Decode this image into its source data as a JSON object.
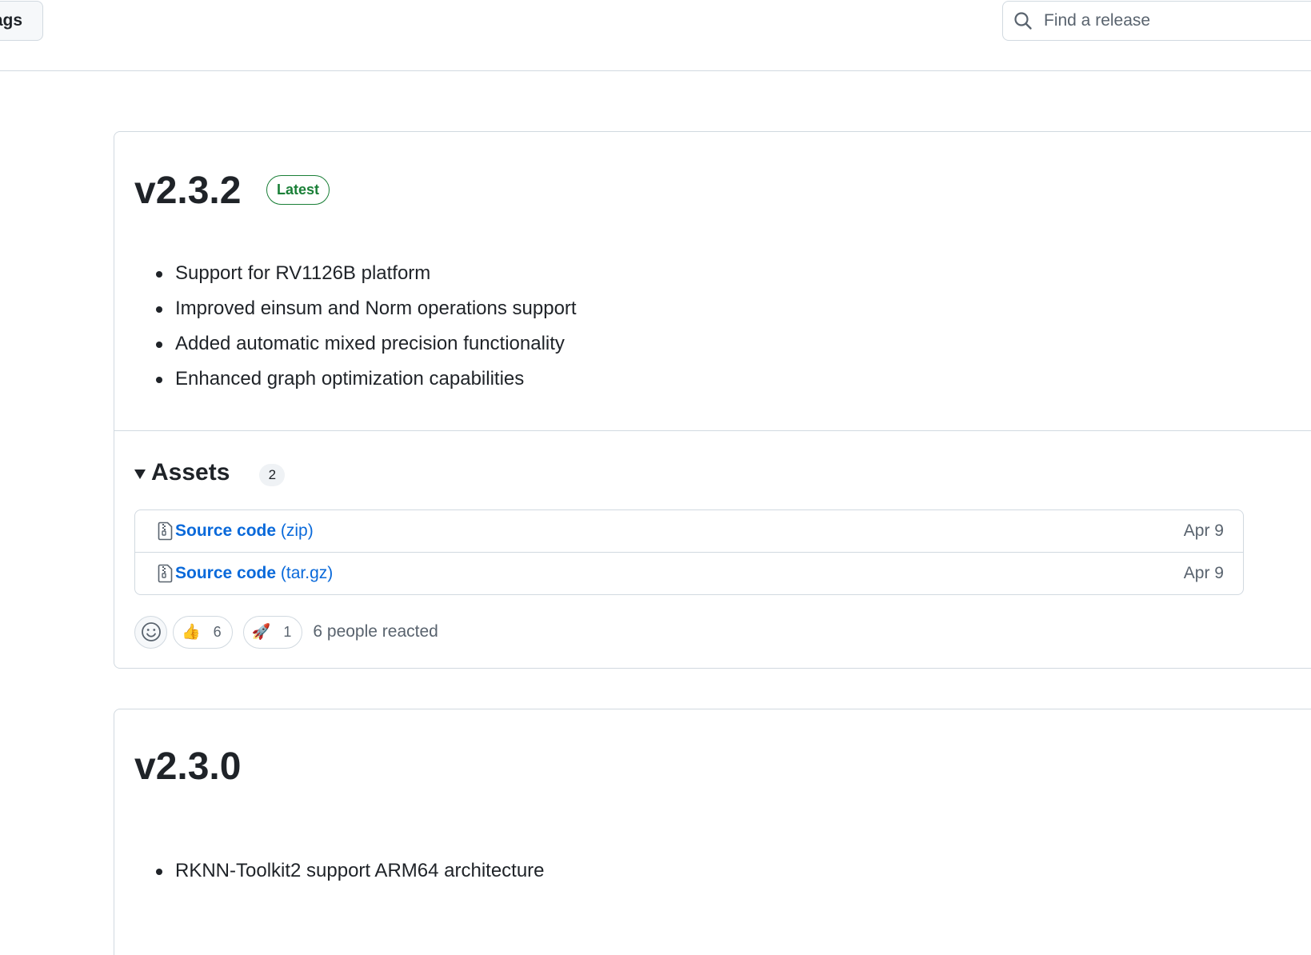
{
  "toolbar": {
    "tags_label": "ags",
    "search_placeholder": "Find a release"
  },
  "releases": [
    {
      "title": "v2.3.2",
      "badge": "Latest",
      "notes": [
        "Support for RV1126B platform",
        "Improved einsum and Norm operations support",
        "Added automatic mixed precision functionality",
        "Enhanced graph optimization capabilities"
      ],
      "assets": {
        "label": "Assets",
        "count": "2",
        "items": [
          {
            "name": "Source code",
            "ext": "(zip)",
            "date": "Apr 9"
          },
          {
            "name": "Source code",
            "ext": "(tar.gz)",
            "date": "Apr 9"
          }
        ]
      },
      "reactions": {
        "items": [
          {
            "emoji": "👍",
            "count": "6"
          },
          {
            "emoji": "🚀",
            "count": "1"
          }
        ],
        "summary": "6 people reacted"
      }
    },
    {
      "title": "v2.3.0",
      "notes": [
        "RKNN-Toolkit2 support ARM64 architecture"
      ]
    }
  ],
  "colors": {
    "accent_link": "#0969da",
    "latest_green": "#1a7f37",
    "border": "#d1d9e0",
    "muted_text": "#59636e"
  },
  "icons": [
    "search-icon",
    "file-zip-icon",
    "smiley-icon",
    "thumbs-up-icon",
    "rocket-icon",
    "triangle-down-icon"
  ]
}
